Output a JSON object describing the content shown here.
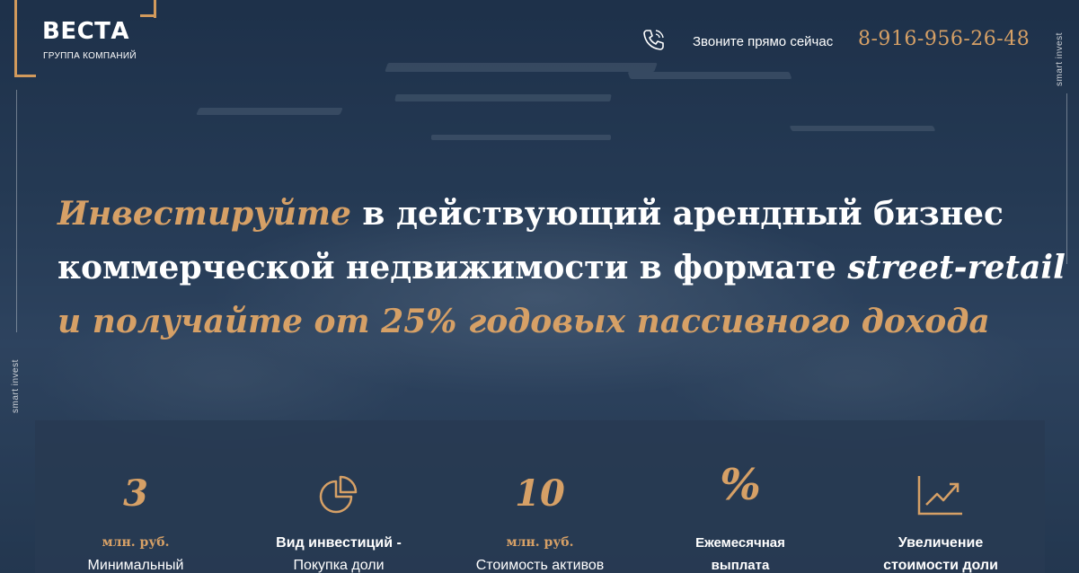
{
  "brand": {
    "name": "ВЕСТА",
    "subtitle": "ГРУППА КОМПАНИЙ"
  },
  "header": {
    "call_label": "Звоните прямо сейчас",
    "phone": "8-916-956-26-48"
  },
  "side_text": "smart invest",
  "headline": {
    "line1_accent": "Инвестируйте",
    "line1_rest": " в действующий арендный бизнес",
    "line2_rest": "коммерческой недвижимости в формате ",
    "line2_accent": "street-retail",
    "line3_accent": "и получайте от 25% годовых пассивного дохода"
  },
  "stats": [
    {
      "big": "3",
      "unit": "млн. руб.",
      "label": "Минимальный"
    },
    {
      "icon": "pie-chart-icon",
      "label_bold": "Вид инвестиций -",
      "label": "Покупка доли"
    },
    {
      "big": "10",
      "unit": "млн. руб.",
      "label": "Стоимость активов"
    },
    {
      "big": "%",
      "label_bold": "Ежемесячная",
      "label_bold2": "выплата"
    },
    {
      "icon": "growth-chart-icon",
      "label_bold": "Увеличение",
      "label_bold2": "стоимости доли"
    }
  ],
  "colors": {
    "accent": "#d6a066",
    "panel": "#283a52",
    "background": "#2b3f57"
  }
}
